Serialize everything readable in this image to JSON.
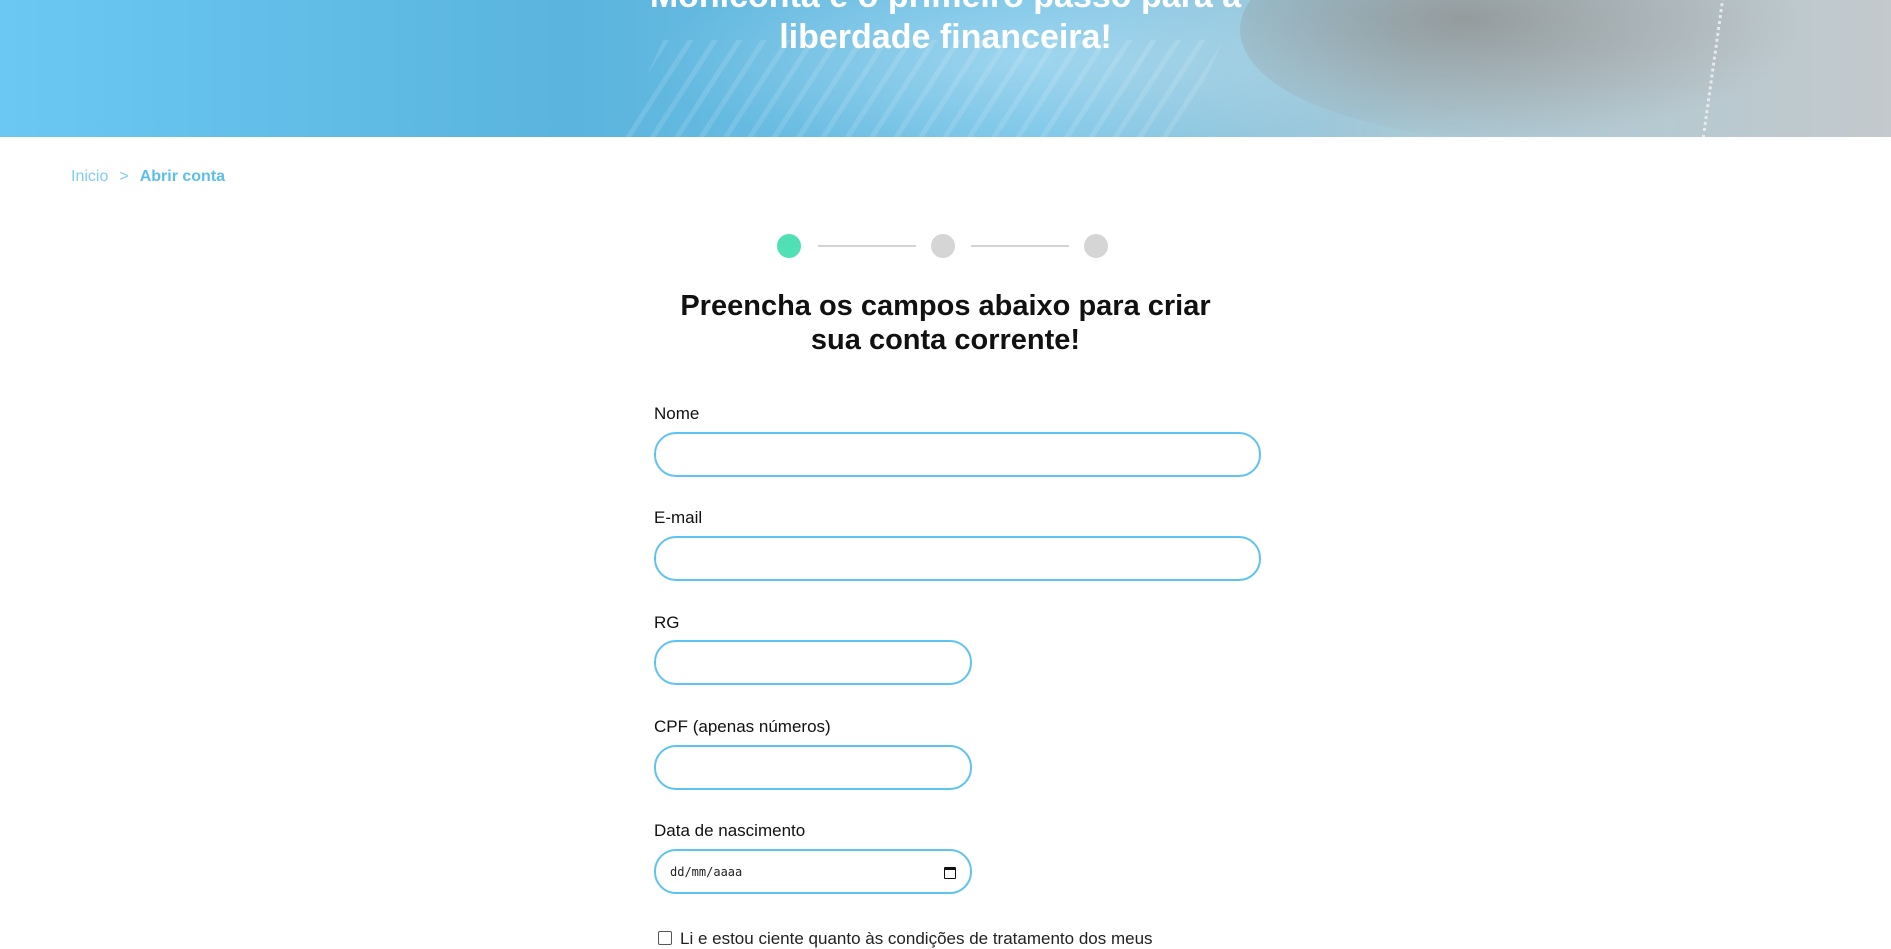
{
  "hero": {
    "title_line1": "Monicônta é o primeiro passo para a",
    "title_line2": "liberdade financeira!"
  },
  "breadcrumb": {
    "home": "Inicio",
    "separator": ">",
    "current": "Abrir conta"
  },
  "stepper": {
    "total_steps": 3,
    "current_step": 1,
    "active_color": "#4fe0b6",
    "inactive_color": "#d5d5d5"
  },
  "form": {
    "heading_line1": "Preencha os campos abaixo para criar",
    "heading_line2": "sua conta corrente!",
    "fields": {
      "nome": {
        "label": "Nome",
        "value": ""
      },
      "email": {
        "label": "E-mail",
        "value": ""
      },
      "rg": {
        "label": "RG",
        "value": ""
      },
      "cpf": {
        "label": "CPF (apenas números)",
        "value": ""
      },
      "nascimento": {
        "label": "Data de nascimento",
        "placeholder": "dd/mm/aaaa",
        "icon": "calendar-icon"
      }
    },
    "consent": {
      "label": "Li e estou ciente quanto às condições de tratamento dos meus",
      "checked": false
    }
  },
  "colors": {
    "accent": "#5fc3ef",
    "breadcrumb": "#7fcdf0"
  }
}
